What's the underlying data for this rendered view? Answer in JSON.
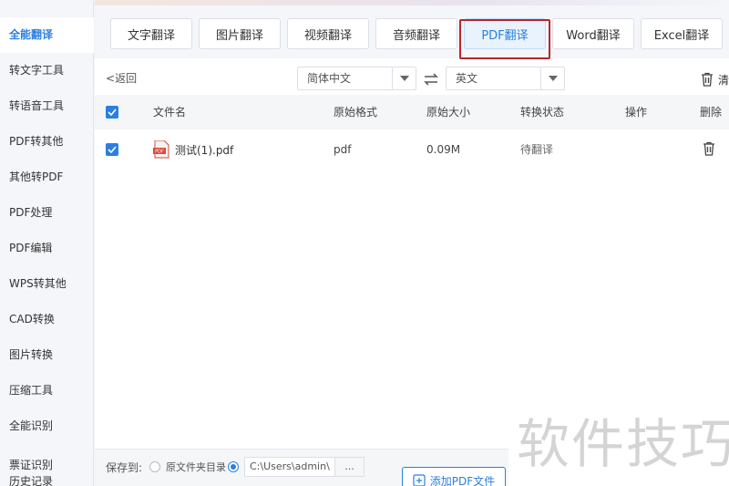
{
  "sidebar": {
    "items": [
      {
        "label": "全能翻译",
        "active": true
      },
      {
        "label": "转文字工具"
      },
      {
        "label": "转语音工具"
      },
      {
        "label": "PDF转其他"
      },
      {
        "label": "其他转PDF"
      },
      {
        "label": "PDF处理"
      },
      {
        "label": "PDF编辑"
      },
      {
        "label": "WPS转其他"
      },
      {
        "label": "CAD转换"
      },
      {
        "label": "图片转换"
      },
      {
        "label": "压缩工具"
      },
      {
        "label": "全能识别"
      },
      {
        "label": "票证识别"
      },
      {
        "label": "历史记录"
      }
    ]
  },
  "tabs": [
    {
      "label": "文字翻译"
    },
    {
      "label": "图片翻译"
    },
    {
      "label": "视频翻译"
    },
    {
      "label": "音频翻译"
    },
    {
      "label": "PDF翻译",
      "active": true
    },
    {
      "label": "Word翻译"
    },
    {
      "label": "Excel翻译"
    }
  ],
  "toolbar": {
    "back_label": "返回",
    "source_lang": "简体中文",
    "target_lang": "英文",
    "clear_label": "清"
  },
  "table": {
    "headers": [
      "文件名",
      "原始格式",
      "原始大小",
      "转换状态",
      "操作",
      "删除"
    ],
    "rows": [
      {
        "file_name": "测试(1).pdf",
        "format": "pdf",
        "size": "0.09M",
        "status": "待翻译"
      }
    ]
  },
  "footer": {
    "save_to_label": "保存到:",
    "option_original": "原文件夹目录",
    "path_value": "C:\\Users\\admin\\",
    "browse_label": "...",
    "add_button_label": "添加PDF文件"
  },
  "watermark": "软件技巧",
  "colors": {
    "accent": "#2a7fe0",
    "highlight_border": "#b8262b"
  }
}
